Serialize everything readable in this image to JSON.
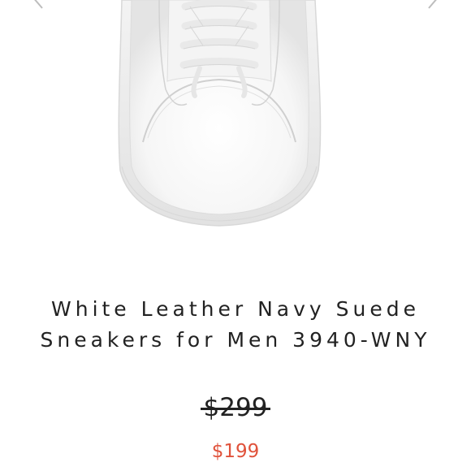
{
  "product": {
    "title": "White Leather Navy Suede Sneakers for Men 3940-WNY",
    "original_price": "$299",
    "sale_price": "$199"
  },
  "image": {
    "subject": "white-leather-sneaker-toe"
  },
  "navigation": {
    "prev_icon": "chevron-left-icon",
    "next_icon": "chevron-right-icon"
  },
  "colors": {
    "background": "#ffffff",
    "text": "#222222",
    "sale_price": "#e0523b"
  }
}
